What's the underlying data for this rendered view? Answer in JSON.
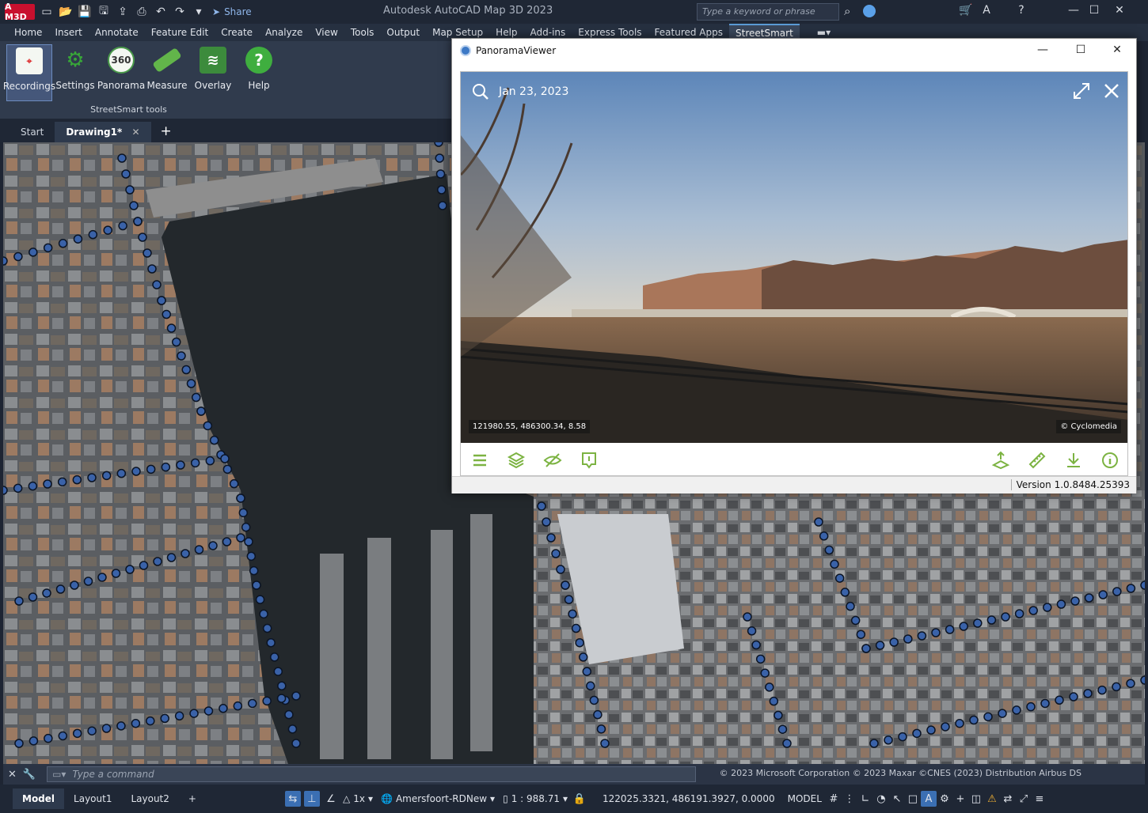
{
  "app": {
    "badge": "A M3D",
    "title": "Autodesk AutoCAD Map 3D 2023",
    "share_label": "Share",
    "search_placeholder": "Type a keyword or phrase"
  },
  "ribbon": {
    "tabs": [
      "Home",
      "Insert",
      "Annotate",
      "Feature Edit",
      "Create",
      "Analyze",
      "View",
      "Tools",
      "Output",
      "Map Setup",
      "Help",
      "Add-ins",
      "Express Tools",
      "Featured Apps",
      "StreetSmart"
    ],
    "active_tab": "StreetSmart",
    "tools": [
      {
        "label": "Recordings",
        "icon": "pin"
      },
      {
        "label": "Settings",
        "icon": "gears"
      },
      {
        "label": "Panorama",
        "icon": "360"
      },
      {
        "label": "Measure",
        "icon": "ruler"
      },
      {
        "label": "Overlay",
        "icon": "layers"
      },
      {
        "label": "Help",
        "icon": "?"
      }
    ],
    "group_label": "StreetSmart tools"
  },
  "doc_tabs": {
    "start": "Start",
    "drawing": "Drawing1*"
  },
  "panorama": {
    "window_title": "PanoramaViewer",
    "date": "Jan 23, 2023",
    "coordinates": "121980.55, 486300.34, 8.58",
    "copyright": "© Cyclomedia",
    "version": "Version 1.0.8484.25393"
  },
  "command": {
    "placeholder": "Type a command",
    "credits": "© 2023 Microsoft Corporation © 2023 Maxar ©CNES (2023) Distribution Airbus DS"
  },
  "status": {
    "layouts": [
      "Model",
      "Layout1",
      "Layout2"
    ],
    "zoom": "1x",
    "coord_system": "Amersfoort-RDNew",
    "scale": "1 : 988.71",
    "coordinates": "122025.3321, 486191.3927, 0.0000",
    "space": "MODEL"
  },
  "colors": {
    "accent_green": "#7cb342",
    "ribbon_bg": "#303b4d",
    "title_bg": "#1f2735"
  }
}
